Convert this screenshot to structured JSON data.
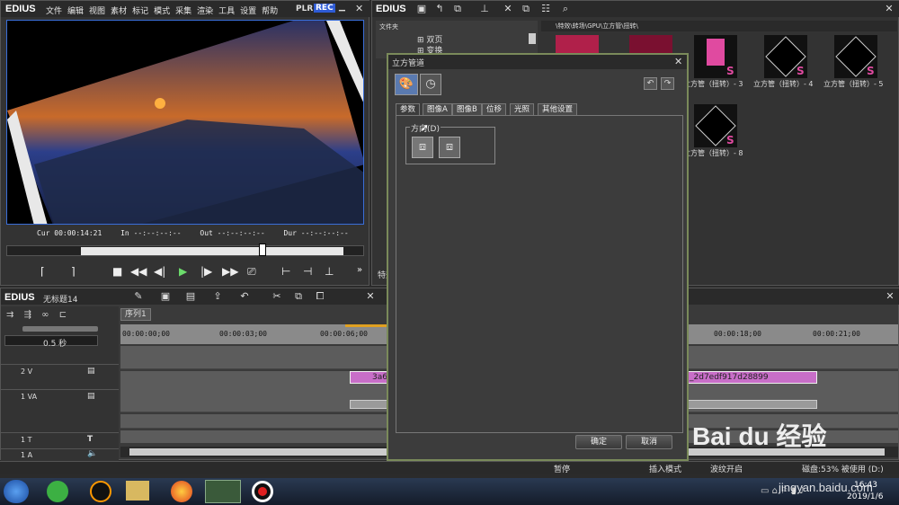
{
  "player": {
    "logo": "EDIUS",
    "menu": [
      "文件",
      "编辑",
      "视图",
      "素材",
      "标记",
      "模式",
      "采集",
      "渲染",
      "工具",
      "设置",
      "帮助"
    ],
    "plr": "PLR",
    "rec": "REC",
    "cur_label": "Cur",
    "cur_value": "00:00:14:21",
    "in_label": "In",
    "in_value": "--:--:--:--",
    "out_label": "Out",
    "out_value": "--:--:--:--",
    "dur_label": "Dur",
    "dur_value": "--:--:--:--"
  },
  "bin": {
    "logo": "EDIUS",
    "folder_header": "文件夹",
    "tree": [
      "双页",
      "变换"
    ],
    "path": "\\特效\\转场\\GPU\\立方管\\扭转\\",
    "thumbs": [
      {
        "label": "立方管（扭转）- 3"
      },
      {
        "label": "立方管（扭转）- 4"
      },
      {
        "label": "立方管（扭转）- 5"
      },
      {
        "label": "立方管（扭转）- 8"
      }
    ],
    "bottom_label": "特效"
  },
  "timeline": {
    "logo": "EDIUS",
    "project": "无标题14",
    "sequence_tab": "序列1",
    "zoom": "0.5 秒",
    "ruler": [
      "00:00:00;00",
      "00:00:03;00",
      "00:00:06;00",
      "00:00:18;00",
      "00:00:21;00"
    ],
    "tracks": [
      "2 V",
      "1 VA",
      "1 T",
      "1 A"
    ],
    "clip_left": "3a68",
    "clip_right": "_2d7edf917d28899"
  },
  "dialog": {
    "title": "立方管道",
    "tabs": [
      "参数",
      "图像A",
      "图像B",
      "位移",
      "光照",
      "其他设置"
    ],
    "group_label": "方向(D)",
    "ok": "确定",
    "cancel": "取消"
  },
  "statusbar": {
    "pause": "暂停",
    "insert_mode": "插入模式",
    "ripple": "波纹开启",
    "disk": "磁盘:53% 被使用 (D:)"
  },
  "taskbar": {
    "time": "16:43",
    "date": "2019/1/6"
  },
  "watermark": {
    "brand": "Bai du 经验",
    "url": "jingyan.baidu.com"
  },
  "colors": {
    "accent_blue": "#3a6ed8",
    "clip_pink": "#c86ec8",
    "timeline_bg": "#8a8a8a",
    "rec_blue": "#2e5bd6"
  }
}
